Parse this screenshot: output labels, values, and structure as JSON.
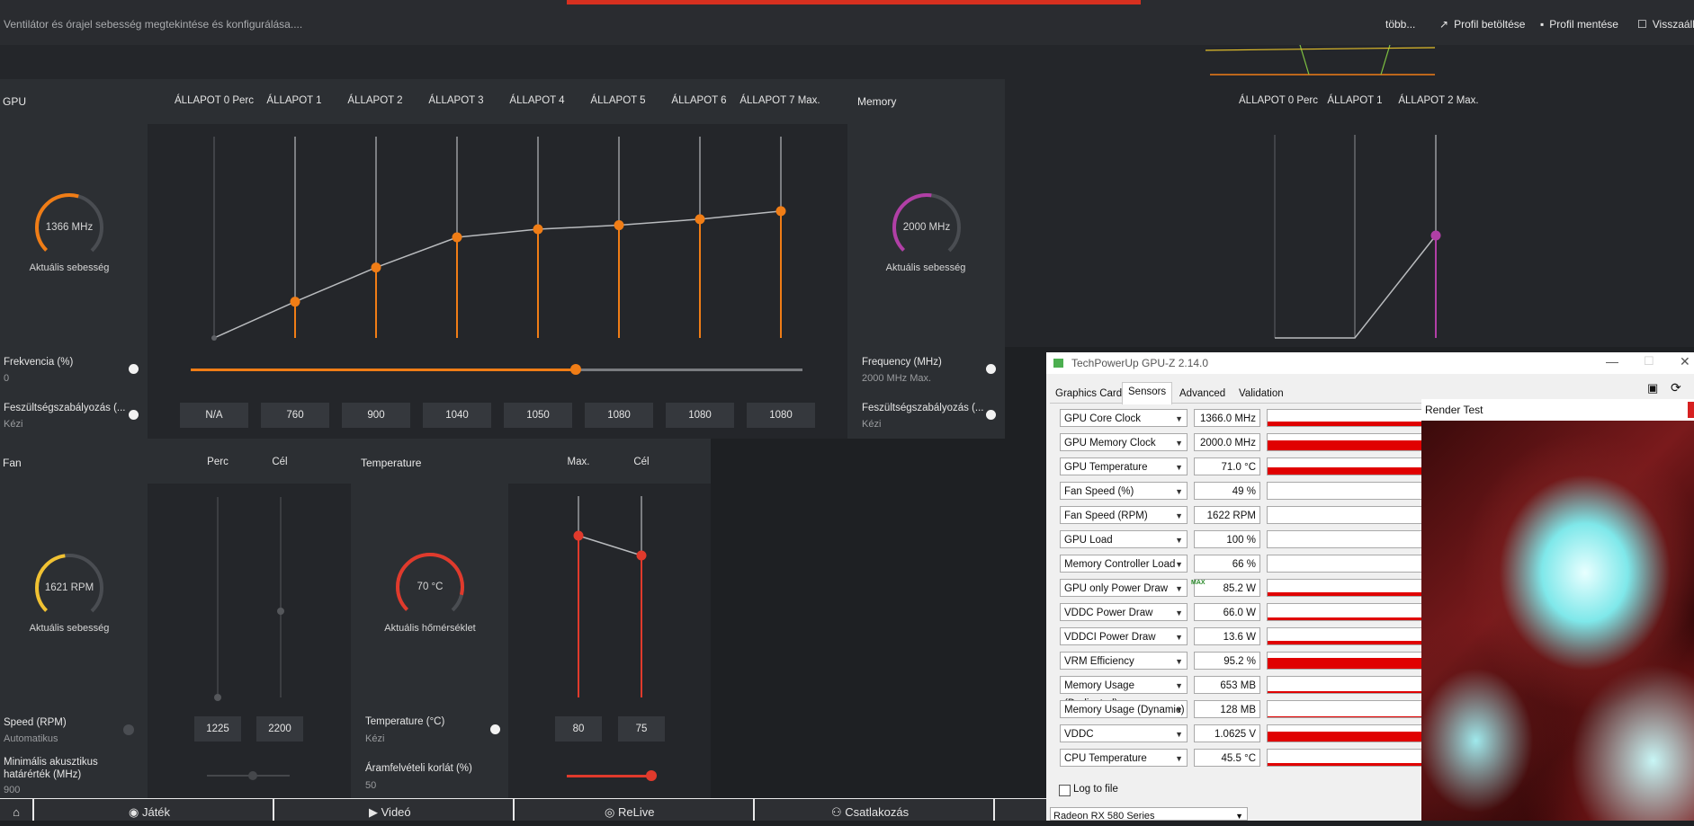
{
  "header": {
    "subtitle": "Ventilátor és órajel sebesség megtekintése és konfigurálása....",
    "more": "több...",
    "load_profile": "Profil betöltése",
    "save_profile": "Profil mentése",
    "reset": "Visszaáll"
  },
  "gpu": {
    "title": "GPU",
    "states": [
      "ÁLLAPOT 0 Perc",
      "ÁLLAPOT 1",
      "ÁLLAPOT 2",
      "ÁLLAPOT 3",
      "ÁLLAPOT 4",
      "ÁLLAPOT 5",
      "ÁLLAPOT 6",
      "ÁLLAPOT 7 Max."
    ],
    "gauge_value": "1366 MHz",
    "gauge_label": "Aktuális sebesség",
    "freq_label": "Frekvencia (%)",
    "freq_value": "0",
    "freq_slider_fraction": 0.63,
    "volt_label": "Feszültségszabályozás (...",
    "volt_mode": "Kézi",
    "voltages": [
      "N/A",
      "760",
      "900",
      "1040",
      "1050",
      "1080",
      "1080",
      "1080"
    ],
    "curve_levels": [
      0.0,
      0.18,
      0.35,
      0.5,
      0.54,
      0.56,
      0.59,
      0.63
    ]
  },
  "memory": {
    "title": "Memory",
    "states": [
      "ÁLLAPOT 0 Perc",
      "ÁLLAPOT 1",
      "ÁLLAPOT 2 Max."
    ],
    "gauge_value": "2000 MHz",
    "gauge_label": "Aktuális sebesség",
    "freq_label": "Frequency (MHz)",
    "freq_value": "2000 MHz Max.",
    "volt_label": "Feszültségszabályozás (...",
    "volt_mode": "Kézi"
  },
  "fan": {
    "title": "Fan",
    "col_min": "Perc",
    "col_target": "Cél",
    "gauge_value": "1621 RPM",
    "gauge_label": "Aktuális sebesség",
    "speed_label": "Speed (RPM)",
    "speed_mode": "Automatikus",
    "min_value": "1225",
    "target_value": "2200",
    "acoustic_label_1": "Minimális akusztikus",
    "acoustic_label_2": "határérték (MHz)",
    "acoustic_value": "900"
  },
  "temperature": {
    "title": "Temperature",
    "col_max": "Max.",
    "col_target": "Cél",
    "gauge_value": "70 °C",
    "gauge_label": "Aktuális hőmérséklet",
    "temp_label": "Temperature (°C)",
    "temp_mode": "Kézi",
    "max_value": "80",
    "target_value": "75",
    "power_label": "Áramfelvételi korlát (%)",
    "power_value": "50"
  },
  "gpuz": {
    "title": "TechPowerUp GPU-Z 2.14.0",
    "tabs": [
      "Graphics Card",
      "Sensors",
      "Advanced",
      "Validation"
    ],
    "sensors": [
      {
        "name": "GPU Core Clock",
        "value": "1366.0 MHz",
        "fill": 0.3
      },
      {
        "name": "GPU Memory Clock",
        "value": "2000.0 MHz",
        "fill": 0.6
      },
      {
        "name": "GPU Temperature",
        "value": "71.0 °C",
        "fill": 0.45
      },
      {
        "name": "Fan Speed (%)",
        "value": "49 %",
        "fill": 0
      },
      {
        "name": "Fan Speed (RPM)",
        "value": "1622 RPM",
        "fill": 0
      },
      {
        "name": "GPU Load",
        "value": "100 %",
        "fill": 0
      },
      {
        "name": "Memory Controller Load",
        "value": "66 %",
        "fill": 0
      },
      {
        "name": "GPU only Power Draw",
        "value": "85.2 W",
        "fill": 0.25
      },
      {
        "name": "VDDC Power Draw",
        "value": "66.0 W",
        "fill": 0.15
      },
      {
        "name": "VDDCI Power Draw",
        "value": "13.6 W",
        "fill": 0.2
      },
      {
        "name": "VRM Efficiency",
        "value": "95.2 %",
        "fill": 0.65
      },
      {
        "name": "Memory Usage (Dedicated)",
        "value": "653 MB",
        "fill": 0.1
      },
      {
        "name": "Memory Usage (Dynamic)",
        "value": "128 MB",
        "fill": 0.05
      },
      {
        "name": "VDDC",
        "value": "1.0625 V",
        "fill": 0.6
      },
      {
        "name": "CPU Temperature",
        "value": "45.5 °C",
        "fill": 0.15
      }
    ],
    "max_badge": "MAX",
    "log_label": "Log to file",
    "device": "Radeon RX 580 Series"
  },
  "render_test": {
    "title": "Render Test"
  },
  "nav": {
    "game": "Játék",
    "video": "Videó",
    "relive": "ReLive",
    "connect": "Csatlakozás"
  },
  "colors": {
    "gpu": "#f07d16",
    "memory": "#b13fa6",
    "fan": "#f1c232",
    "temp": "#e03a2c",
    "graph": "#e00000"
  }
}
